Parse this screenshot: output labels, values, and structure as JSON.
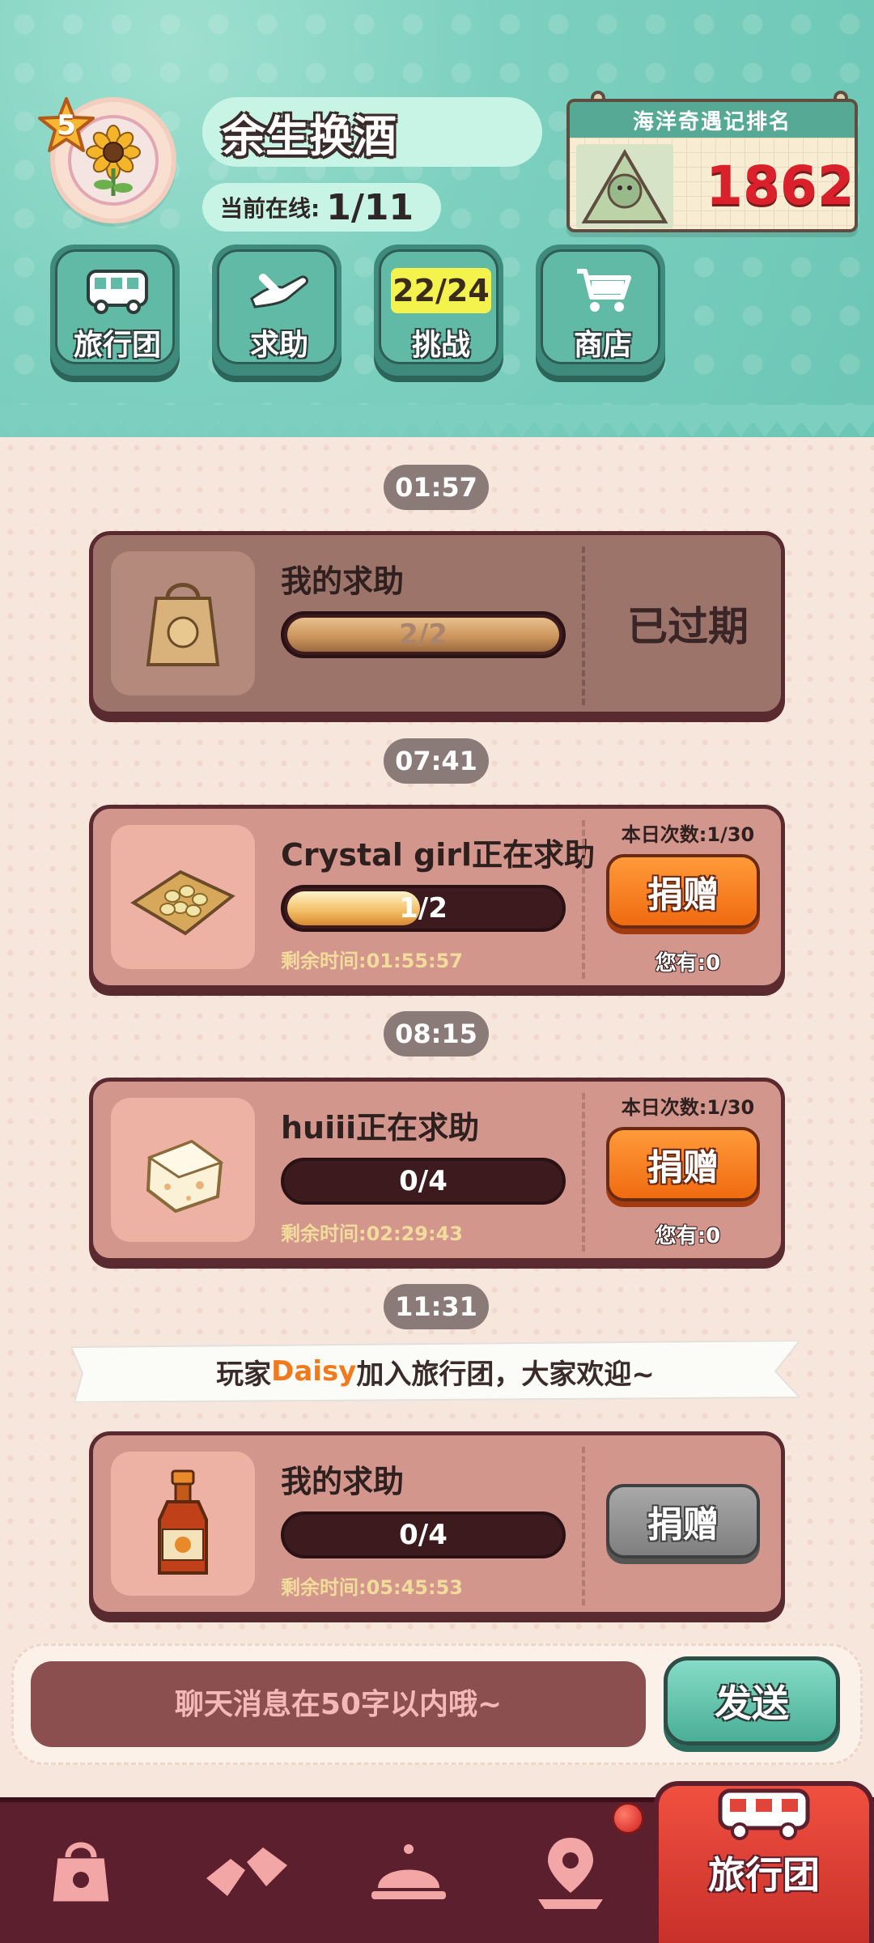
{
  "profile": {
    "level": "5",
    "name": "余生换酒",
    "online_label": "当前在线:",
    "online_value": "1/11"
  },
  "ranking": {
    "title": "海洋奇遇记排名",
    "value": "1862"
  },
  "menu": [
    {
      "label": "旅行团",
      "icon": "bus-icon"
    },
    {
      "label": "求助",
      "icon": "helping-hand-icon"
    },
    {
      "label": "挑战",
      "icon": "challenge-counter",
      "counter": "22/24"
    },
    {
      "label": "商店",
      "icon": "cart-icon"
    }
  ],
  "feed": {
    "times": [
      "01:57",
      "07:41",
      "08:15",
      "11:31"
    ],
    "cards": [
      {
        "title": "我的求助",
        "progress": "2/2",
        "progress_fraction": 1.0,
        "status": "已过期",
        "item_icon": "paper-bag-icon"
      },
      {
        "title": "Crystal girl正在求助",
        "progress": "1/2",
        "progress_fraction": 0.5,
        "remaining": "剩余时间:01:55:57",
        "daily": "本日次数:1/30",
        "button": "捐赠",
        "have": "您有:0",
        "item_icon": "beans-icon"
      },
      {
        "title": "huiii正在求助",
        "progress": "0/4",
        "progress_fraction": 0,
        "remaining": "剩余时间:02:29:43",
        "daily": "本日次数:1/30",
        "button": "捐赠",
        "have": "您有:0",
        "item_icon": "tofu-icon"
      },
      {
        "title": "我的求助",
        "progress": "0/4",
        "progress_fraction": 0,
        "remaining": "剩余时间:05:45:53",
        "button": "捐赠",
        "item_icon": "sauce-bottle-icon"
      }
    ],
    "banner": {
      "prefix": "玩家",
      "player": "Daisy",
      "suffix": "加入旅行团，大家欢迎~"
    }
  },
  "chat": {
    "placeholder": "聊天消息在50字以内哦~",
    "send_label": "发送"
  },
  "nav": {
    "items": [
      "bag-icon",
      "hands-icon",
      "service-bell-icon",
      "map-pin-icon"
    ],
    "active_label": "旅行团",
    "active_icon": "bus-icon"
  },
  "colors": {
    "header_teal": "#7dd0c0",
    "card_bg": "#d3968d",
    "donate_orange": "#f06b10",
    "nav_bg": "#5c1f2d",
    "nav_active": "#e0453a",
    "rank_red": "#d9202b"
  }
}
